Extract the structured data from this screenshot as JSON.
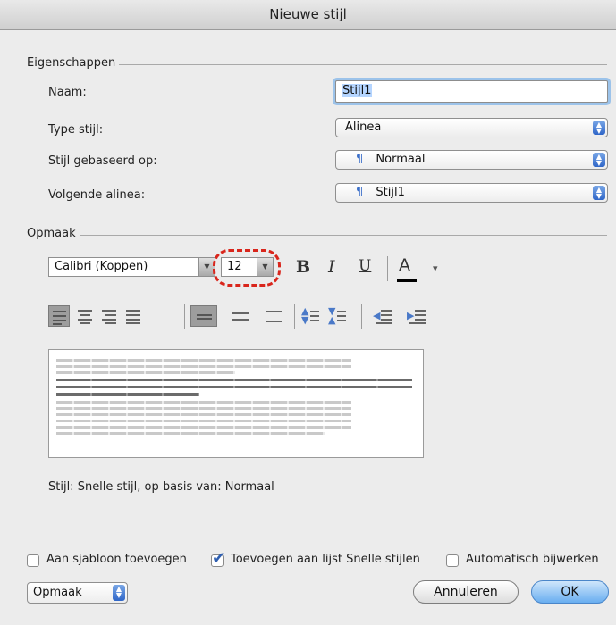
{
  "dialog": {
    "title": "Nieuwe stijl"
  },
  "properties": {
    "section_label": "Eigenschappen",
    "name_label": "Naam:",
    "name_value": "Stijl1",
    "type_label": "Type stijl:",
    "type_value": "Alinea",
    "based_on_label": "Stijl gebaseerd op:",
    "based_on_value": "Normaal",
    "next_label": "Volgende alinea:",
    "next_value": "Stijl1",
    "paragraph_mark": "¶"
  },
  "formatting": {
    "section_label": "Opmaak",
    "font_name": "Calibri (Koppen)",
    "font_size": "12",
    "bold": "B",
    "italic": "I",
    "underline": "U",
    "font_color_glyph": "A",
    "font_color_arrow": "▾",
    "highlight_color": "#d9261c"
  },
  "description": "Stijl: Snelle stijl, op basis van: Normaal",
  "options": {
    "add_to_template": {
      "label": "Aan sjabloon toevoegen",
      "checked": false
    },
    "add_to_quick_styles": {
      "label": "Toevoegen aan lijst Snelle stijlen",
      "checked": true
    },
    "auto_update": {
      "label": "Automatisch bijwerken",
      "checked": false
    }
  },
  "footer": {
    "format_menu_label": "Opmaak",
    "cancel_label": "Annuleren",
    "ok_label": "OK"
  },
  "icons": {
    "popup_arrows": "⇕",
    "check": "✔"
  }
}
